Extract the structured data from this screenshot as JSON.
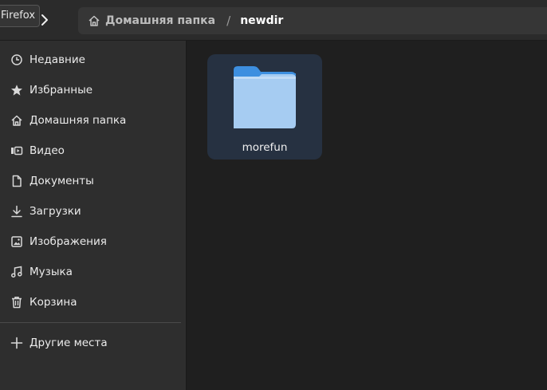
{
  "tooltip": {
    "text": "Firefox"
  },
  "header": {
    "path": {
      "home_label": "Домашняя папка",
      "separator": "/",
      "current": "newdir"
    }
  },
  "sidebar": {
    "items": [
      {
        "label": "Недавние",
        "icon": "clock-icon"
      },
      {
        "label": "Избранные",
        "icon": "star-icon"
      },
      {
        "label": "Домашняя папка",
        "icon": "home-icon"
      },
      {
        "label": "Видео",
        "icon": "video-icon"
      },
      {
        "label": "Документы",
        "icon": "document-icon"
      },
      {
        "label": "Загрузки",
        "icon": "download-icon"
      },
      {
        "label": "Изображения",
        "icon": "image-icon"
      },
      {
        "label": "Музыка",
        "icon": "music-icon"
      },
      {
        "label": "Корзина",
        "icon": "trash-icon"
      }
    ],
    "other_places": {
      "label": "Другие места",
      "icon": "plus-icon"
    }
  },
  "content": {
    "files": [
      {
        "name": "morefun",
        "type": "folder",
        "selected": true
      }
    ]
  },
  "colors": {
    "accent_folder_top": "#3d8fe0",
    "accent_folder_front": "#a6ccf2",
    "selection_bg": "#263141"
  }
}
